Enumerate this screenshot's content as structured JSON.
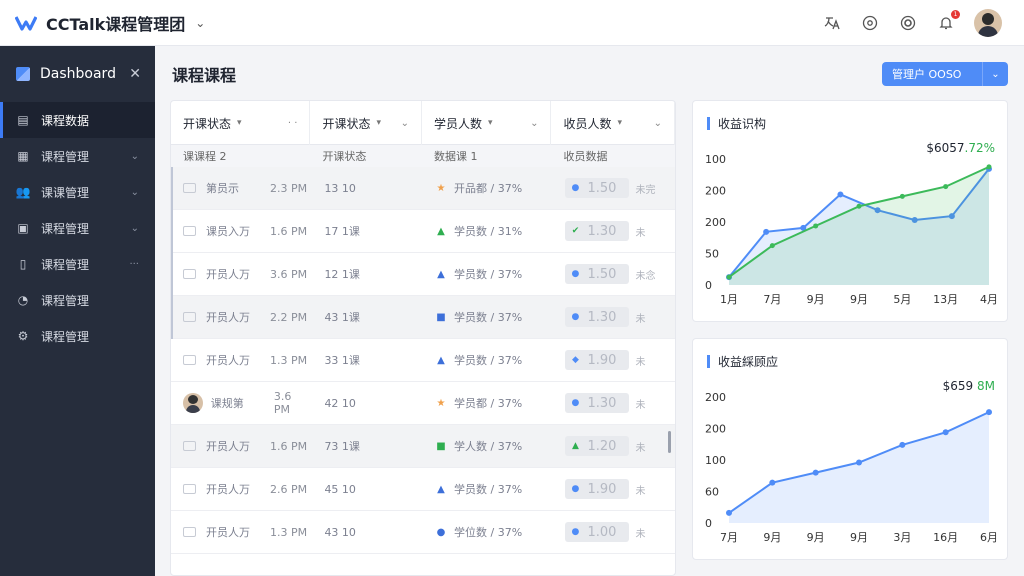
{
  "app": {
    "title": "CCTalk课程管理团",
    "chev": "⌄"
  },
  "topbar": {
    "icons": [
      "translate-icon",
      "clock-icon",
      "settings-icon",
      "bell-icon",
      "avatar"
    ],
    "bell_badge": "1"
  },
  "sidebar": {
    "header": "Dashboard",
    "items": [
      {
        "label": "课程数据",
        "icon": "course-icon",
        "active": true,
        "arrow": ""
      },
      {
        "label": "课程管理",
        "icon": "table-icon",
        "active": false,
        "arrow": "⌄"
      },
      {
        "label": "课课管理",
        "icon": "users-icon",
        "active": false,
        "arrow": "⌄"
      },
      {
        "label": "课程管理",
        "icon": "box-icon",
        "active": false,
        "arrow": "⌄"
      },
      {
        "label": "课程管理",
        "icon": "doc-icon",
        "active": false,
        "arrow": "···"
      },
      {
        "label": "课程管理",
        "icon": "chart-icon",
        "active": false,
        "arrow": ""
      },
      {
        "label": "课程管理",
        "icon": "gear-icon",
        "active": false,
        "arrow": ""
      }
    ]
  },
  "main": {
    "title": "课程课程",
    "button_label": "管理户 OOSO",
    "button_caret": "⌄"
  },
  "table": {
    "headers": [
      {
        "label": "开课状态",
        "dd": "▾",
        "sort": "· ·"
      },
      {
        "label": "开课状态",
        "dd": "▾",
        "sort": "⌄"
      },
      {
        "label": "学员人数",
        "dd": "▾",
        "sort": "⌄"
      },
      {
        "label": "收员人数",
        "dd": "▾",
        "sort": "⌄"
      }
    ],
    "subheaders": [
      "课课程 2",
      "开课状态",
      "数据课 1",
      "收员数据"
    ],
    "rows": [
      {
        "icon": "mail",
        "name": "第员示",
        "time": "2.3 PM",
        "count": "13 10",
        "mark": "★",
        "markColor": "#f0a04b",
        "stat": "开品都 / 37%",
        "pillMark": "●",
        "pillColor": "#4f8cf7",
        "pill": "1.50",
        "tag": "未完",
        "grey": true,
        "bar": true
      },
      {
        "icon": "mail",
        "name": "课员入万",
        "time": "1.6 PM",
        "count": "17 1课",
        "mark": "▲",
        "markColor": "#2fae50",
        "stat": "学员数 / 31%",
        "pillMark": "✔",
        "pillColor": "#2fae50",
        "pill": "1.30",
        "tag": "未",
        "grey": false,
        "bar": true
      },
      {
        "icon": "mail",
        "name": "开员人万",
        "time": "3.6 PM",
        "count": "12 1课",
        "mark": "▲",
        "markColor": "#3d6fd9",
        "stat": "学员数 / 37%",
        "pillMark": "●",
        "pillColor": "#4f8cf7",
        "pill": "1.50",
        "tag": "未念",
        "grey": false,
        "bar": true
      },
      {
        "icon": "mail",
        "name": "开员人万",
        "time": "2.2 PM",
        "count": "43 1课",
        "mark": "■",
        "markColor": "#3d6fd9",
        "stat": "学员数 / 37%",
        "pillMark": "●",
        "pillColor": "#4f8cf7",
        "pill": "1.30",
        "tag": "未",
        "grey": true,
        "bar": true
      },
      {
        "icon": "mail",
        "name": "开员人万",
        "time": "1.3 PM",
        "count": "33 1课",
        "mark": "▲",
        "markColor": "#3d6fd9",
        "stat": "学员数 / 37%",
        "pillMark": "◆",
        "pillColor": "#4f8cf7",
        "pill": "1.90",
        "tag": "未",
        "grey": false,
        "bar": false
      },
      {
        "icon": "avatar",
        "name": "课规第",
        "time": "3.6 PM",
        "count": "42 10",
        "mark": "★",
        "markColor": "#f0a04b",
        "stat": "学员都 / 37%",
        "pillMark": "●",
        "pillColor": "#4f8cf7",
        "pill": "1.30",
        "tag": "未",
        "grey": false,
        "bar": false
      },
      {
        "icon": "mail",
        "name": "开员人万",
        "time": "1.6 PM",
        "count": "73 1课",
        "mark": "■",
        "markColor": "#2fae50",
        "stat": "学人数 / 37%",
        "pillMark": "▲",
        "pillColor": "#2fae50",
        "pill": "1.20",
        "tag": "未",
        "grey": true,
        "bar": false
      },
      {
        "icon": "mail",
        "name": "开员人万",
        "time": "2.6 PM",
        "count": "45 10",
        "mark": "▲",
        "markColor": "#3d6fd9",
        "stat": "学员数 / 37%",
        "pillMark": "●",
        "pillColor": "#4f8cf7",
        "pill": "1.90",
        "tag": "未",
        "grey": false,
        "bar": false
      },
      {
        "icon": "mail",
        "name": "开员人万",
        "time": "1.3 PM",
        "count": "43 10",
        "mark": "●",
        "markColor": "#3d6fd9",
        "stat": "学位数 / 37%",
        "pillMark": "●",
        "pillColor": "#4f8cf7",
        "pill": "1.00",
        "tag": "未",
        "grey": false,
        "bar": false
      }
    ]
  },
  "chart_data": [
    {
      "type": "line",
      "title": "收益识构",
      "value_label": "$6057",
      "value_pct": ".72%",
      "y_ticks": [
        "100",
        "200",
        "200",
        "50",
        "0"
      ],
      "x_ticks": [
        "1月",
        "7月",
        "9月",
        "9月",
        "5月",
        "13月",
        "4月"
      ],
      "ylim": [
        0,
        320
      ],
      "series": [
        {
          "color": "#4f8cf7",
          "values": [
            20,
            135,
            145,
            230,
            190,
            165,
            175,
            295
          ]
        },
        {
          "color": "#3cba5a",
          "values": [
            20,
            100,
            150,
            200,
            225,
            250,
            300
          ]
        }
      ]
    },
    {
      "type": "area",
      "title": "收益綵顾应",
      "value_label": "$659",
      "value_pct": "8M",
      "y_ticks": [
        "200",
        "200",
        "100",
        "60",
        "0"
      ],
      "x_ticks": [
        "7月",
        "9月",
        "9月",
        "9月",
        "3月",
        "16月",
        "6月"
      ],
      "ylim": [
        0,
        250
      ],
      "series": [
        {
          "color": "#4f8cf7",
          "values": [
            20,
            80,
            100,
            120,
            155,
            180,
            220
          ]
        }
      ]
    }
  ]
}
